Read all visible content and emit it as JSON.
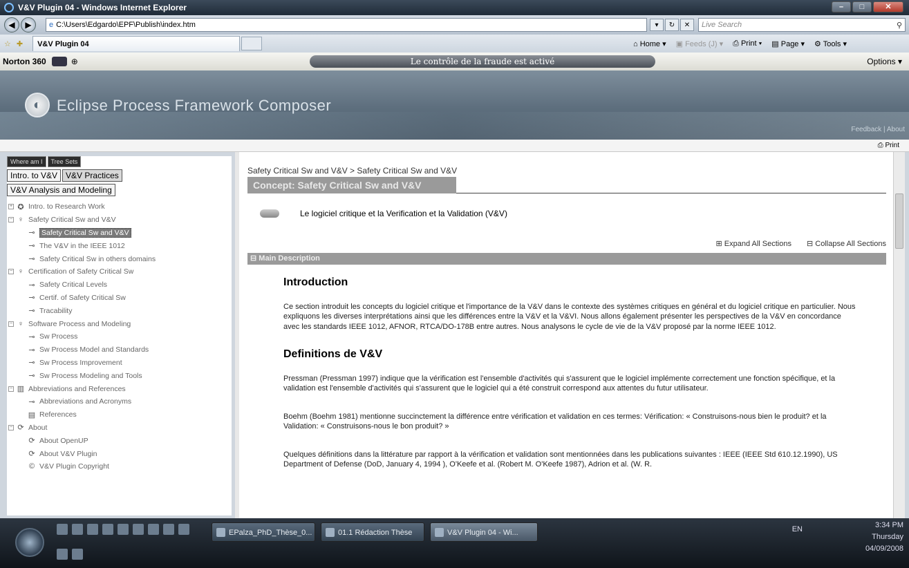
{
  "window": {
    "title": "V&V Plugin 04 - Windows Internet Explorer"
  },
  "address": {
    "url": "C:\\Users\\Edgardo\\EPF\\Publish\\index.htm",
    "search_placeholder": "Live Search"
  },
  "tab": {
    "title": "V&V Plugin 04"
  },
  "commandbar": {
    "home": "Home",
    "feeds": "Feeds (J)",
    "print": "Print",
    "page": "Page",
    "tools": "Tools"
  },
  "norton": {
    "brand": "Norton 360",
    "fraud": "Le contrôle de la fraude est activé",
    "options": "Options"
  },
  "banner": {
    "title": "Eclipse Process Framework Composer",
    "links": "Feedback | About"
  },
  "printbar": {
    "print": "Print"
  },
  "left": {
    "view_tabs": [
      "Where am I",
      "Tree Sets"
    ],
    "set_tabs": [
      "Intro. to V&V",
      "V&V Practices",
      "V&V Analysis and Modeling"
    ],
    "tree": [
      "Intro. to Research Work",
      "Safety Critical Sw and V&V",
      "Safety Critical Sw and V&V",
      "The V&V in the IEEE 1012",
      "Safety Critical Sw in others domains",
      "Certification of Safety Critical Sw",
      "Safety Critical Levels",
      "Certif. of Safety Critical Sw",
      "Tracability",
      "Software Process and Modeling",
      "Sw Process",
      "Sw Process Model and Standards",
      "Sw Process Improvement",
      "Sw Process Modeling and Tools",
      "Abbreviations and References",
      "Abbreviations and Acronyms",
      "References",
      "About",
      "About OpenUP",
      "About V&V Plugin",
      "V&V Plugin Copyright"
    ]
  },
  "content": {
    "breadcrumb": "Safety Critical Sw and V&V > Safety Critical Sw and V&V",
    "concept_title": "Concept: Safety Critical Sw and V&V",
    "brief": "Le logiciel critique et la Verification et la Validation (V&V)",
    "expand_all": "Expand All Sections",
    "collapse_all": "Collapse All Sections",
    "section_title": "Main Description",
    "h_intro": "Introduction",
    "p_intro": "Ce section introduit les concepts du logiciel critique et l'importance de la V&V dans le contexte des systèmes critiques en général et du logiciel critique en particulier. Nous expliquons les diverses interprétations ainsi que les différences entre la V&V et la V&VI. Nous allons également présenter les perspectives de la V&V en concordance avec les standards IEEE 1012, AFNOR, RTCA/DO-178B entre autres. Nous analysons le cycle de vie de la V&V proposé par la norme IEEE 1012.",
    "h_defs": "Definitions de V&V",
    "p_defs1": "Pressman (Pressman 1997) indique que la vérification est l'ensemble d'activités qui s'assurent que le logiciel implémente correctement une fonction spécifique, et la validation est l'ensemble d'activités qui s'assurent que le logiciel qui a été construit correspond aux attentes du futur utilisateur.",
    "p_defs2": "Boehm (Boehm 1981) mentionne succinctement la différence entre vérification et validation en ces termes: Vérification: « Construisons-nous bien le produit? et la Validation: « Construisons-nous le bon produit? »",
    "p_defs3": "Quelques définitions dans la littérature par rapport à la vérification et validation sont mentionnées dans les publications suivantes : IEEE (IEEE Std 610.12.1990), US Department of Defense (DoD, January 4, 1994 ), O'Keefe et al. (Robert M. O'Keefe 1987), Adrion et al. (W. R."
  },
  "taskbar": {
    "buttons": [
      "EPalza_PhD_Thèse_0...",
      "01.1 Rédaction Thèse",
      "V&V Plugin 04 - Wi..."
    ],
    "lang": "EN",
    "time": "3:34 PM",
    "day": "Thursday",
    "date": "04/09/2008"
  }
}
